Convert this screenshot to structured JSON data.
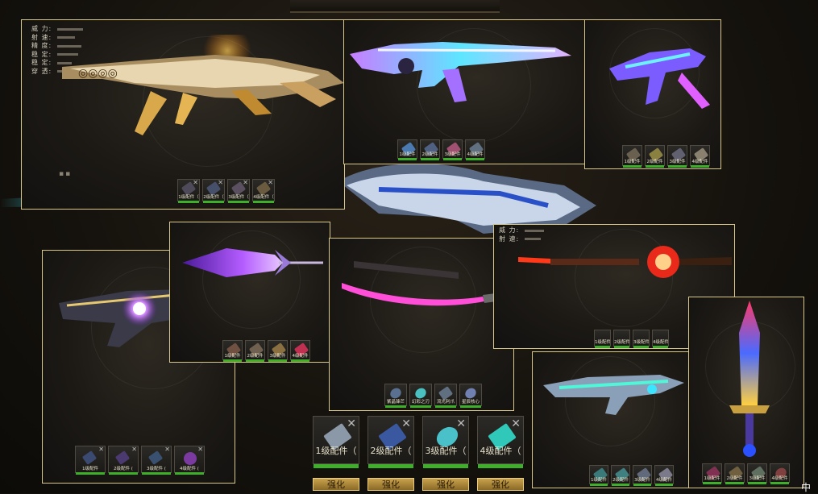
{
  "stat_labels": [
    "威 力:",
    "射 速:",
    "精 度:",
    "稳 定:",
    "稳 定:",
    "穿 透:"
  ],
  "stat_labels_short": [
    "威 力:",
    "射 速:"
  ],
  "panel1_slots": [
    "1级配件（",
    "2级配件（",
    "3级配件（",
    "4级配件（"
  ],
  "panel2_slots": [
    "1级配件",
    "2级配件",
    "3级配件",
    "4级配件"
  ],
  "panel3_slots": [
    "1级配件",
    "2级配件",
    "3级配件",
    "4级配件"
  ],
  "panel4_slots": [
    "1级配件",
    "2级配件 (",
    "3级配件 (",
    "4级配件 ("
  ],
  "panel5_slots": [
    "1级配件",
    "2级配件",
    "3级配件",
    "4级配件"
  ],
  "panel6_slots": [
    "紫晶锋芒",
    "幻彩之刃",
    "流光利爪",
    "星辰核心"
  ],
  "panel7_slots": [
    "1级配件",
    "2级配件",
    "3级配件",
    "4级配件"
  ],
  "panel8_slots": [
    "1级配件",
    "2级配件",
    "3级配件",
    "4级配件"
  ],
  "panel9_slots": [
    "1级配件",
    "2级配件",
    "3级配件",
    "4级配件"
  ],
  "big_slots": [
    "1级配件（",
    "2级配件（",
    "3级配件（",
    "4级配件（"
  ],
  "enhance_label": "强化",
  "corner_char": "中",
  "colors": {
    "border": "#d8c98a",
    "green_bar": "#3fae2a",
    "button_gold": "#c9a24c"
  }
}
